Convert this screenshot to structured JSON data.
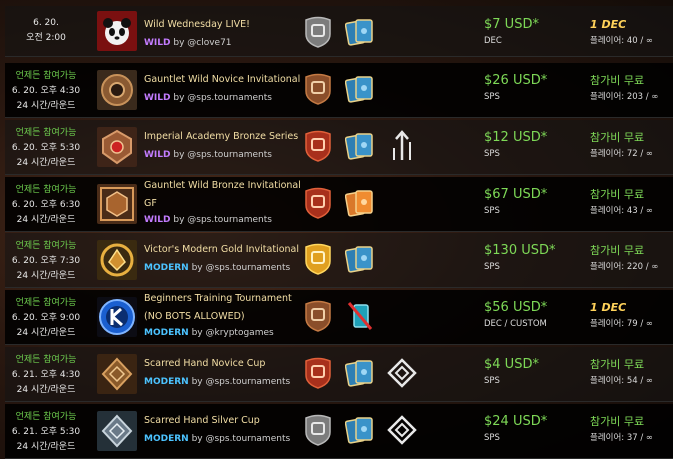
{
  "tournaments": [
    {
      "availability": "",
      "date": "6. 20.",
      "time": "오전 2:00",
      "round_info": "",
      "name": "Wild Wednesday LIVE!",
      "format": "WILD",
      "by": "by @clove71",
      "prize": "$7 USD*",
      "prize_currency": "DEC",
      "entry_fee": "1 DEC",
      "players": "플레이어: 40 / ∞",
      "logo_icon": "panda-logo-icon",
      "league_icon": "silver-league-icon",
      "cards_icon": "cards-icon",
      "extra_icon": ""
    },
    {
      "availability": "언제든 참여가능",
      "date": "6. 20. 오후 4:30",
      "time": "",
      "round_info": "24 시간/라운드",
      "name": "Gauntlet Wild Novice Invitational",
      "format": "WILD",
      "by": "by @sps.tournaments",
      "prize": "$26 USD*",
      "prize_currency": "SPS",
      "entry_fee": "참가비 무료",
      "players": "플레이어: 203 / ∞",
      "logo_icon": "bronze-shield-logo-icon",
      "league_icon": "bronze-league-icon",
      "cards_icon": "cards-icon",
      "extra_icon": ""
    },
    {
      "availability": "언제든 참여가능",
      "date": "6. 20. 오후 5:30",
      "time": "",
      "round_info": "24 시간/라운드",
      "name": "Imperial Academy Bronze Series",
      "format": "WILD",
      "by": "by @sps.tournaments",
      "prize": "$12 USD*",
      "prize_currency": "SPS",
      "entry_fee": "참가비 무료",
      "players": "플레이어: 72 / ∞",
      "logo_icon": "bronze-crest-logo-icon",
      "league_icon": "red-league-icon",
      "cards_icon": "cards-icon",
      "extra_icon": "arrow-ruleset-icon"
    },
    {
      "availability": "언제든 참여가능",
      "date": "6. 20. 오후 6:30",
      "time": "",
      "round_info": "24 시간/라운드",
      "name": "Gauntlet Wild Bronze Invitational GF",
      "format": "WILD",
      "by": "by @sps.tournaments",
      "prize": "$67 USD*",
      "prize_currency": "SPS",
      "entry_fee": "참가비 무료",
      "players": "플레이어: 43 / ∞",
      "logo_icon": "bronze-frame-logo-icon",
      "league_icon": "red-league-icon",
      "cards_icon": "orange-cards-icon",
      "extra_icon": ""
    },
    {
      "availability": "언제든 참여가능",
      "date": "6. 20. 오후 7:30",
      "time": "",
      "round_info": "24 시간/라운드",
      "name": "Victor's Modern Gold Invitational",
      "format": "MODERN",
      "by": "by @sps.tournaments",
      "prize": "$130 USD*",
      "prize_currency": "SPS",
      "entry_fee": "참가비 무료",
      "players": "플레이어: 220 / ∞",
      "logo_icon": "gold-wreath-logo-icon",
      "league_icon": "gold-league-icon",
      "cards_icon": "cards-icon",
      "extra_icon": ""
    },
    {
      "availability": "언제든 참여가능",
      "date": "6. 20. 오후 9:00",
      "time": "",
      "round_info": "24 시간/라운드",
      "name": "Beginners Training Tournament (NO BOTS ALLOWED)",
      "format": "MODERN",
      "by": "by @kryptogames",
      "prize": "$56 USD*",
      "prize_currency": "DEC / CUSTOM",
      "entry_fee": "1 DEC",
      "players": "플레이어: 79 / ∞",
      "logo_icon": "kg-logo-icon",
      "league_icon": "bronze-league-icon",
      "cards_icon": "no-cards-icon",
      "extra_icon": ""
    },
    {
      "availability": "언제든 참여가능",
      "date": "6. 21. 오후 4:30",
      "time": "",
      "round_info": "24 시간/라운드",
      "name": "Scarred Hand Novice Cup",
      "format": "MODERN",
      "by": "by @sps.tournaments",
      "prize": "$4 USD*",
      "prize_currency": "SPS",
      "entry_fee": "참가비 무료",
      "players": "플레이어: 54 / ∞",
      "logo_icon": "scarred-hand-logo-icon",
      "league_icon": "red-league-icon",
      "cards_icon": "cards-icon",
      "extra_icon": "diamond-ruleset-icon"
    },
    {
      "availability": "언제든 참여가능",
      "date": "6. 21. 오후 5:30",
      "time": "",
      "round_info": "24 시간/라운드",
      "name": "Scarred Hand Silver Cup",
      "format": "MODERN",
      "by": "by @sps.tournaments",
      "prize": "$24 USD*",
      "prize_currency": "SPS",
      "entry_fee": "참가비 무료",
      "players": "플레이어: 37 / ∞",
      "logo_icon": "scarred-hand-silver-logo-icon",
      "league_icon": "silver-league-icon",
      "cards_icon": "cards-icon",
      "extra_icon": "diamond-ruleset-icon"
    }
  ]
}
